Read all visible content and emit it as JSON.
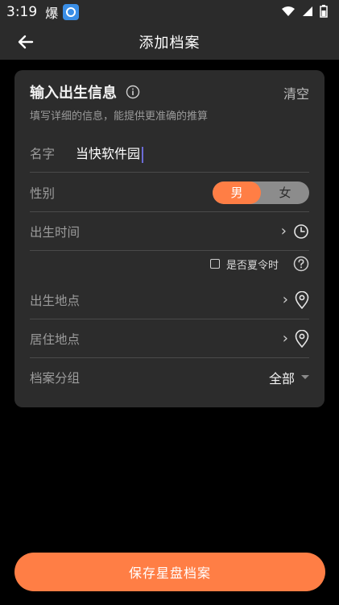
{
  "status_bar": {
    "time": "3:19",
    "extra": "爆"
  },
  "nav": {
    "title": "添加档案"
  },
  "card": {
    "title": "输入出生信息",
    "clear": "清空",
    "subtitle": "填写详细的信息，能提供更准确的推算"
  },
  "form": {
    "name": {
      "label": "名字",
      "value": "当快软件园"
    },
    "gender": {
      "label": "性别",
      "options": [
        "男",
        "女"
      ],
      "selected": "男"
    },
    "birth_time": {
      "label": "出生时间",
      "chevron": "›"
    },
    "dst": {
      "label": "是否夏令时",
      "checked": false
    },
    "birth_place": {
      "label": "出生地点",
      "chevron": "›"
    },
    "residence": {
      "label": "居住地点",
      "chevron": "›"
    },
    "group": {
      "label": "档案分组",
      "value": "全部"
    }
  },
  "save_button": "保存星盘档案",
  "colors": {
    "accent": "#ff7e45",
    "card": "#2c2c2c",
    "bar": "#2b2b2b"
  }
}
